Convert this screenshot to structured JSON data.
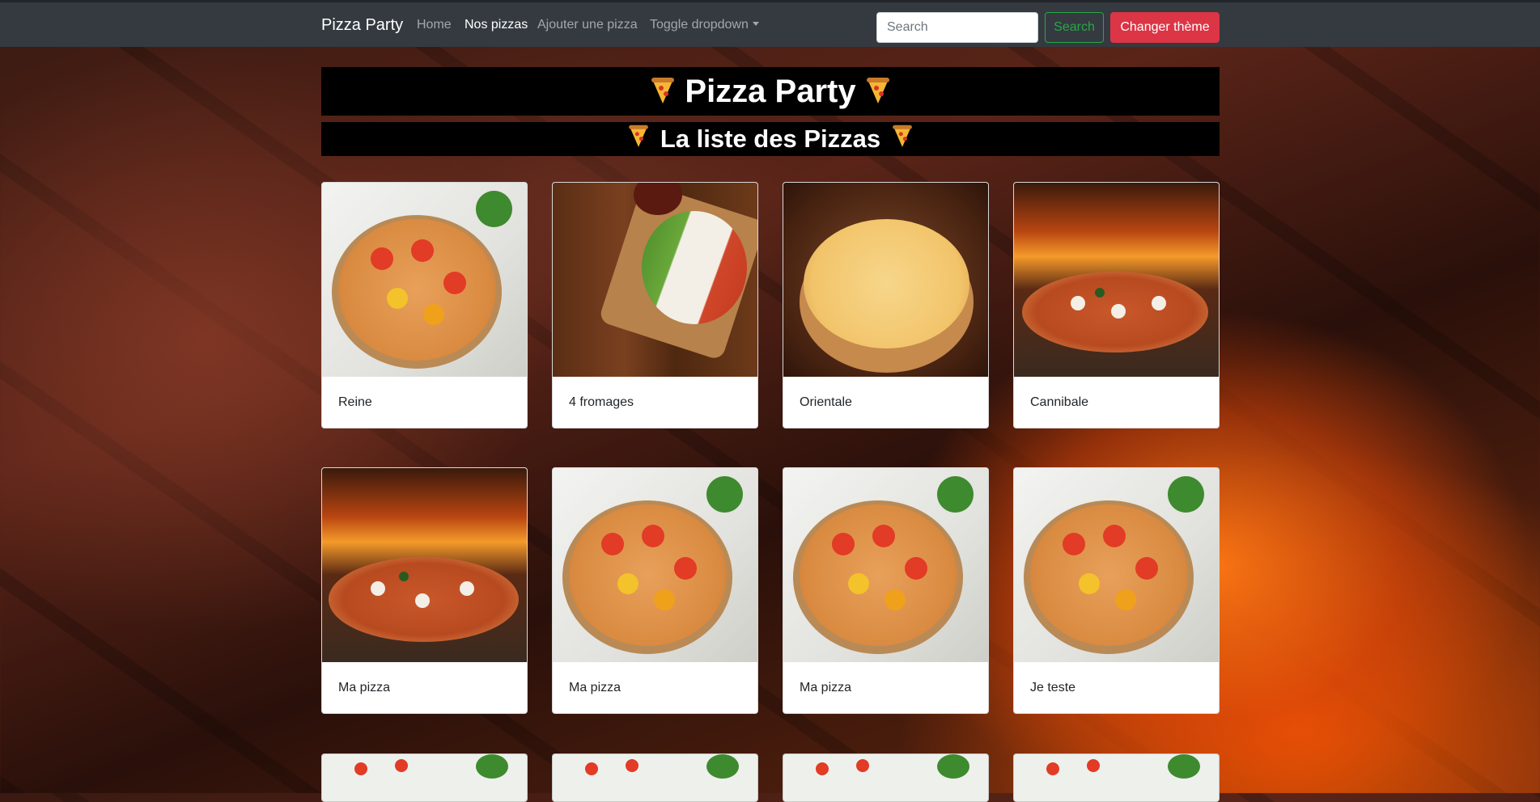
{
  "navbar": {
    "brand": "Pizza Party",
    "links": [
      {
        "label": "Home",
        "active": false
      },
      {
        "label": "Nos pizzas",
        "active": true
      },
      {
        "label": "Ajouter une pizza",
        "active": false
      },
      {
        "label": "Toggle dropdown",
        "active": false
      }
    ],
    "search_placeholder": "Search",
    "search_button": "Search",
    "theme_button": "Changer thème"
  },
  "header": {
    "title": "Pizza Party",
    "subtitle": "La liste des Pizzas",
    "icon": "pizza-slice-icon"
  },
  "pizzas": [
    {
      "name": "Reine",
      "image": "pizza-white-table"
    },
    {
      "name": "4 fromages",
      "image": "pizza-wood-board"
    },
    {
      "name": "Orientale",
      "image": "pizza-cheese-board"
    },
    {
      "name": "Cannibale",
      "image": "pizza-fire-oven"
    },
    {
      "name": "Ma pizza",
      "image": "pizza-fire-oven"
    },
    {
      "name": "Ma pizza",
      "image": "pizza-white-table"
    },
    {
      "name": "Ma pizza",
      "image": "pizza-white-table"
    },
    {
      "name": "Je teste",
      "image": "pizza-white-table"
    }
  ],
  "colors": {
    "navbar_bg": "#343a40",
    "search_btn": "#28a745",
    "theme_btn": "#dc3545",
    "banner_bg": "#000000"
  }
}
